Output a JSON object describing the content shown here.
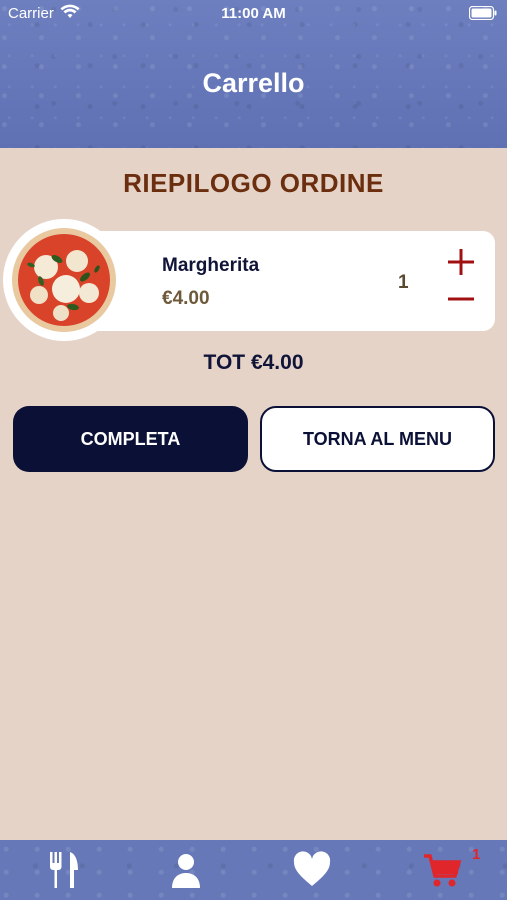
{
  "status_bar": {
    "carrier": "Carrier",
    "time": "11:00 AM"
  },
  "header": {
    "title": "Carrello"
  },
  "summary": {
    "title": "RIEPILOGO ORDINE"
  },
  "cart_items": [
    {
      "name": "Margherita",
      "price": "€4.00",
      "quantity": "1"
    }
  ],
  "total": "TOT €4.00",
  "actions": {
    "complete_label": "COMPLETA",
    "back_label": "TORNA AL MENU"
  },
  "tab_bar": {
    "items": [
      {
        "icon": "fork-knife-icon"
      },
      {
        "icon": "user-icon"
      },
      {
        "icon": "heart-icon"
      },
      {
        "icon": "cart-icon",
        "badge": "1"
      }
    ]
  },
  "colors": {
    "header_blue": "#6678b8",
    "background": "#e6d3c8",
    "title_brown": "#6b2e0e",
    "dark_navy": "#0b1136",
    "accent_red": "#e0262b",
    "control_red": "#a01010"
  }
}
